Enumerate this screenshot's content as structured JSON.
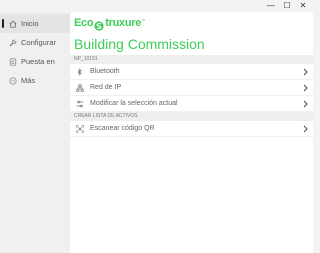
{
  "window": {
    "controls": {
      "minimize": "—",
      "maximize": "☐",
      "close": "✕"
    }
  },
  "sidebar": {
    "items": [
      {
        "label": "Inicio",
        "icon": "home-icon",
        "active": true
      },
      {
        "label": "Configurar",
        "icon": "wrench-icon",
        "active": false
      },
      {
        "label": "Puesta en",
        "icon": "checklist-icon",
        "active": false
      },
      {
        "label": "Más",
        "icon": "more-circle-icon",
        "active": false
      }
    ]
  },
  "brand": {
    "part1": "Eco",
    "part2": "truxure",
    "tm": "™",
    "color": "#3dcd58"
  },
  "main": {
    "title": "Building Commission",
    "section1": {
      "header": "NP_10151",
      "rows": [
        {
          "label": "Bluetooth",
          "icon": "bluetooth-icon"
        },
        {
          "label": "Red de IP",
          "icon": "network-icon"
        },
        {
          "label": "Modificar la selección actual",
          "icon": "sliders-icon"
        }
      ]
    },
    "section2": {
      "header": "CREAR LISTA DE ACTIVOS",
      "rows": [
        {
          "label": "Escanear código QR",
          "icon": "qr-code-icon"
        }
      ]
    }
  }
}
